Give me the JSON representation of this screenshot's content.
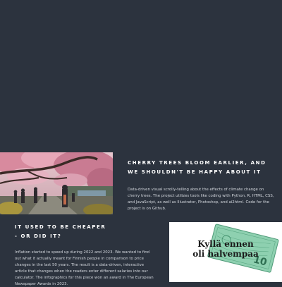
{
  "projects": [
    {
      "title_line1": "CHERRY TREES BLOOM EARLIER, AND",
      "title_line2": "WE SHOULDN'T BE HAPPY ABOUT IT",
      "description": "Data-driven visual scrolly-telling about the effects of climate change on cherry trees. The project utilizes tools like coding with Python, R, HTML, CSS, and JavaScript, as well as Illustrator, Photoshop, and ai2html.",
      "code_link_text": "Code for the project is on Github."
    },
    {
      "title_line1": "IT USED TO BE CHEAPER",
      "title_line2": "- OR DID IT?",
      "description": "Inflation started to speed up during 2022 and 2023. We wanted to find out what it actually meant for Finnish people in comparison to price changes in the last 50 years. The result is a data-driven, interactive article that changes when the readers enter different salaries into our calculator. The infographics for this piece won an award in The European Newspaper Awards in 2023.",
      "image_text_line1": "Kyllä ennen",
      "image_text_line2": "oli halvempaa"
    }
  ],
  "colors": {
    "background": "#2c333e",
    "title": "#ffffff",
    "body_text": "#d3d7dd",
    "banknote_green": "#8ed0b0"
  }
}
